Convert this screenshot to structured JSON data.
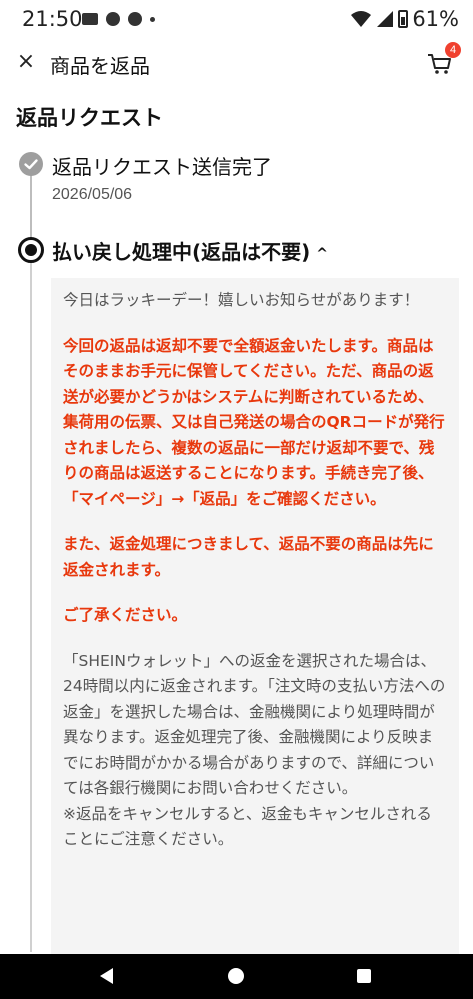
{
  "status_bar": {
    "time": "21:50",
    "battery": "61%"
  },
  "app_bar": {
    "close_glyph": "×",
    "title": "商品を返品",
    "cart_badge": "4"
  },
  "section": {
    "title": "返品リクエスト"
  },
  "timeline": {
    "step1": {
      "title": "返品リクエスト送信完了",
      "date": "2026/05/06"
    },
    "step2": {
      "title": "払い戻し処理中(返品は不要)",
      "chevron": "^"
    }
  },
  "info": {
    "intro": "今日はラッキーデー！嬉しいお知らせがあります！",
    "red1": "今回の返品は返却不要で全額返金いたします。商品はそのままお手元に保管してください。ただ、商品の返送が必要かどうかはシステムに判断されているため、集荷用の伝票、又は自己発送の場合のQRコードが発行されましたら、複数の返品に一部だけ返却不要で、残りの商品は返送することになります。手続き完了後、「マイページ」→「返品」をご確認ください。",
    "red2": "また、返金処理につきまして、返品不要の商品は先に返金されます。",
    "red3": "ご了承ください。",
    "gray1": "「SHEINウォレット」への返金を選択された場合は、24時間以内に返金されます。「注文時の支払い方法への返金」を選択した場合は、金融機関により処理時間が異なります。返金処理完了後、金融機関により反映までにお時間がかかる場合がありますので、詳細については各銀行機関にお問い合わせください。",
    "gray2": "※返品をキャンセルすると、返金もキャンセルされることにご注意ください。"
  },
  "colors": {
    "accent_red": "#e8380d",
    "badge_red": "#f0412f"
  }
}
